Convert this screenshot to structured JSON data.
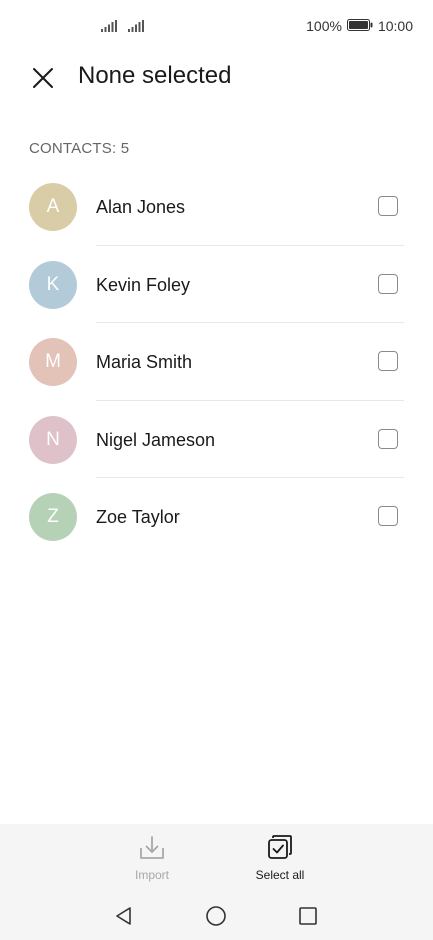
{
  "status_bar": {
    "battery_percent": "100%",
    "time": "10:00"
  },
  "header": {
    "title": "None selected"
  },
  "section": {
    "label": "CONTACTS: 5"
  },
  "contacts": [
    {
      "initial": "A",
      "name": "Alan Jones",
      "color": "#d8cda6",
      "selected": false
    },
    {
      "initial": "K",
      "name": "Kevin Foley",
      "color": "#b3cad9",
      "selected": false
    },
    {
      "initial": "M",
      "name": "Maria Smith",
      "color": "#e3c2b8",
      "selected": false
    },
    {
      "initial": "N",
      "name": "Nigel Jameson",
      "color": "#dfc2c9",
      "selected": false
    },
    {
      "initial": "Z",
      "name": "Zoe Taylor",
      "color": "#b6d2b6",
      "selected": false
    }
  ],
  "bottom_actions": {
    "import_label": "Import",
    "select_all_label": "Select all"
  },
  "icons": {
    "close": "close-icon",
    "import": "import-icon",
    "select_all": "select-all-icon",
    "back": "back-triangle-icon",
    "home": "home-circle-icon",
    "recents": "recents-square-icon"
  }
}
